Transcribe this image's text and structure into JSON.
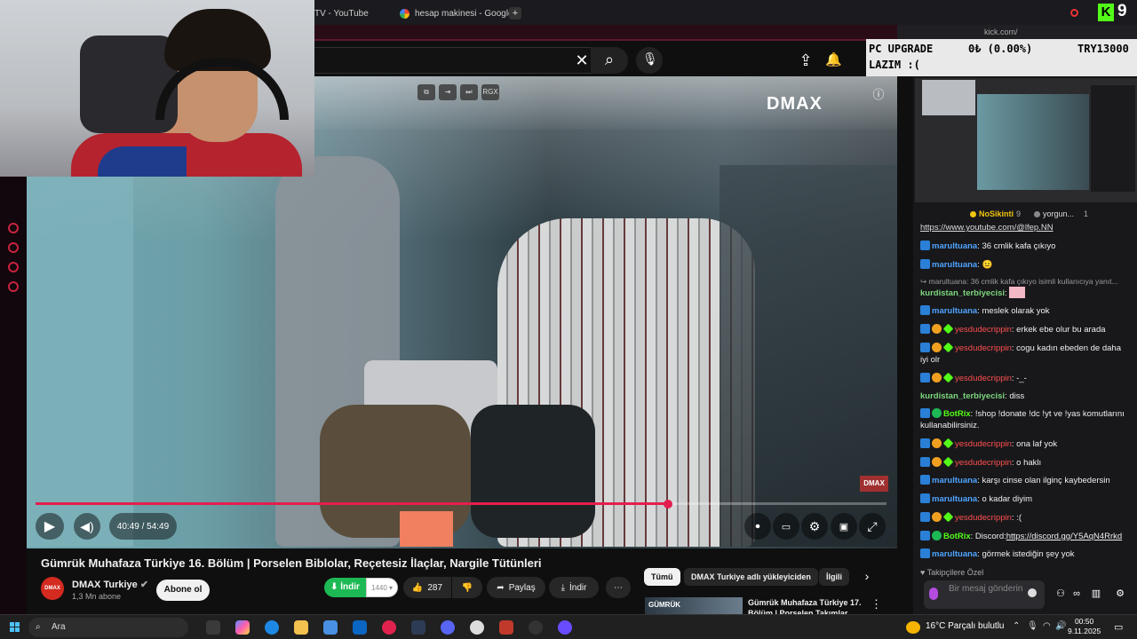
{
  "browser": {
    "tabs": [
      {
        "label": "TV - YouTube"
      },
      {
        "label": "hesap makinesi - Google"
      }
    ],
    "kick_count": "9",
    "kick_url": "kick.com/"
  },
  "video": {
    "channel_logo": "DMAX",
    "time": "40:49 / 54:49",
    "progress_fraction": 0.7427,
    "overlay_buttons": [
      "⧉",
      "⇥",
      "⏭",
      "RGX"
    ]
  },
  "details": {
    "title": "Gümrük Muhafaza Türkiye 16. Bölüm | Porselen Biblolar, Reçetesiz İlaçlar, Nargile Tütünleri",
    "channel": "DMAX Turkiye",
    "subs": "1,3 Mn abone",
    "subscribe": "Abone ol",
    "dl_label": "İndir",
    "dl_quality": "1440",
    "likes": "287",
    "share": "Paylaş",
    "download": "İndir",
    "more": "⋯",
    "avatar_text": "DMAX"
  },
  "chips": [
    "Tümü",
    "DMAX Turkiye adlı yükleyiciden",
    "İlgili"
  ],
  "recommended": {
    "thumb_text": "GÜMRÜK",
    "title": "Gümrük Muhafaza Türkiye 17. Bölüm | Porselen Takımlar"
  },
  "overlay": {
    "line1_left": "PC UPGRADE",
    "line1_mid": "0₺ (0.00%)",
    "line1_right": "TRY13000",
    "line2": "LAZIM :("
  },
  "poll": {
    "left": "NoSikinti",
    "left_count": "9",
    "right": "yorgun...",
    "right_count": "1"
  },
  "chat": {
    "pinned_link": "https://www.youtube.com/@lfep.NN",
    "messages": [
      {
        "user": "marultuana",
        "text": ": 36 cmlik kafa çıkıyo"
      },
      {
        "user": "marultuana",
        "text": ": 😐"
      },
      {
        "reply": "↪ marultuana: 36 cmlik kafa çıkıyo isimli kullanıcıya yanıt..."
      },
      {
        "user": "kurdistan_terbiyecisi",
        "text": ":"
      },
      {
        "user": "marultuana",
        "text": ": meslek olarak yok"
      },
      {
        "user": "yesdudecrippin",
        "text": ": erkek ebe olur bu arada"
      },
      {
        "user": "yesdudecrippin",
        "text": ": cogu kadın ebeden de daha iyi olr"
      },
      {
        "user": "yesdudecrippin",
        "text": ": -_-"
      },
      {
        "user": "kurdistan_terbiyecisi",
        "text": ": diss"
      },
      {
        "user": "BotRix",
        "text": ": !shop !donate !dc !yt ve !yas komutlarını kullanabilirsiniz."
      },
      {
        "user": "yesdudecrippin",
        "text": ": ona laf yok"
      },
      {
        "user": "yesdudecrippin",
        "text": ": o haklı"
      },
      {
        "user": "marultuana",
        "text": ": karşı cinse olan ilginç kaybedersin"
      },
      {
        "user": "marultuana",
        "text": ": o kadar diyim"
      },
      {
        "user": "yesdudecrippin",
        "text": ": :("
      },
      {
        "user": "BotRix",
        "text": ": Discord:",
        "link": "https://discord.gg/Y5AqN4Rrkd"
      },
      {
        "user": "marultuana",
        "text": ": görmek istediğin şey yok"
      }
    ],
    "followers_only": "♥ Takipçilere Özel",
    "input_placeholder": "Bir mesaj gönderin"
  },
  "taskbar": {
    "search": "Ara",
    "weather": "16°C  Parçalı bulutlu",
    "time": "00:50",
    "date": "9.11.2025"
  },
  "colors": {
    "accent": "#e61e4d",
    "kick_green": "#53fc18",
    "chat_user_blue": "#4fa4ff",
    "chat_user_red": "#ff4f4f"
  }
}
